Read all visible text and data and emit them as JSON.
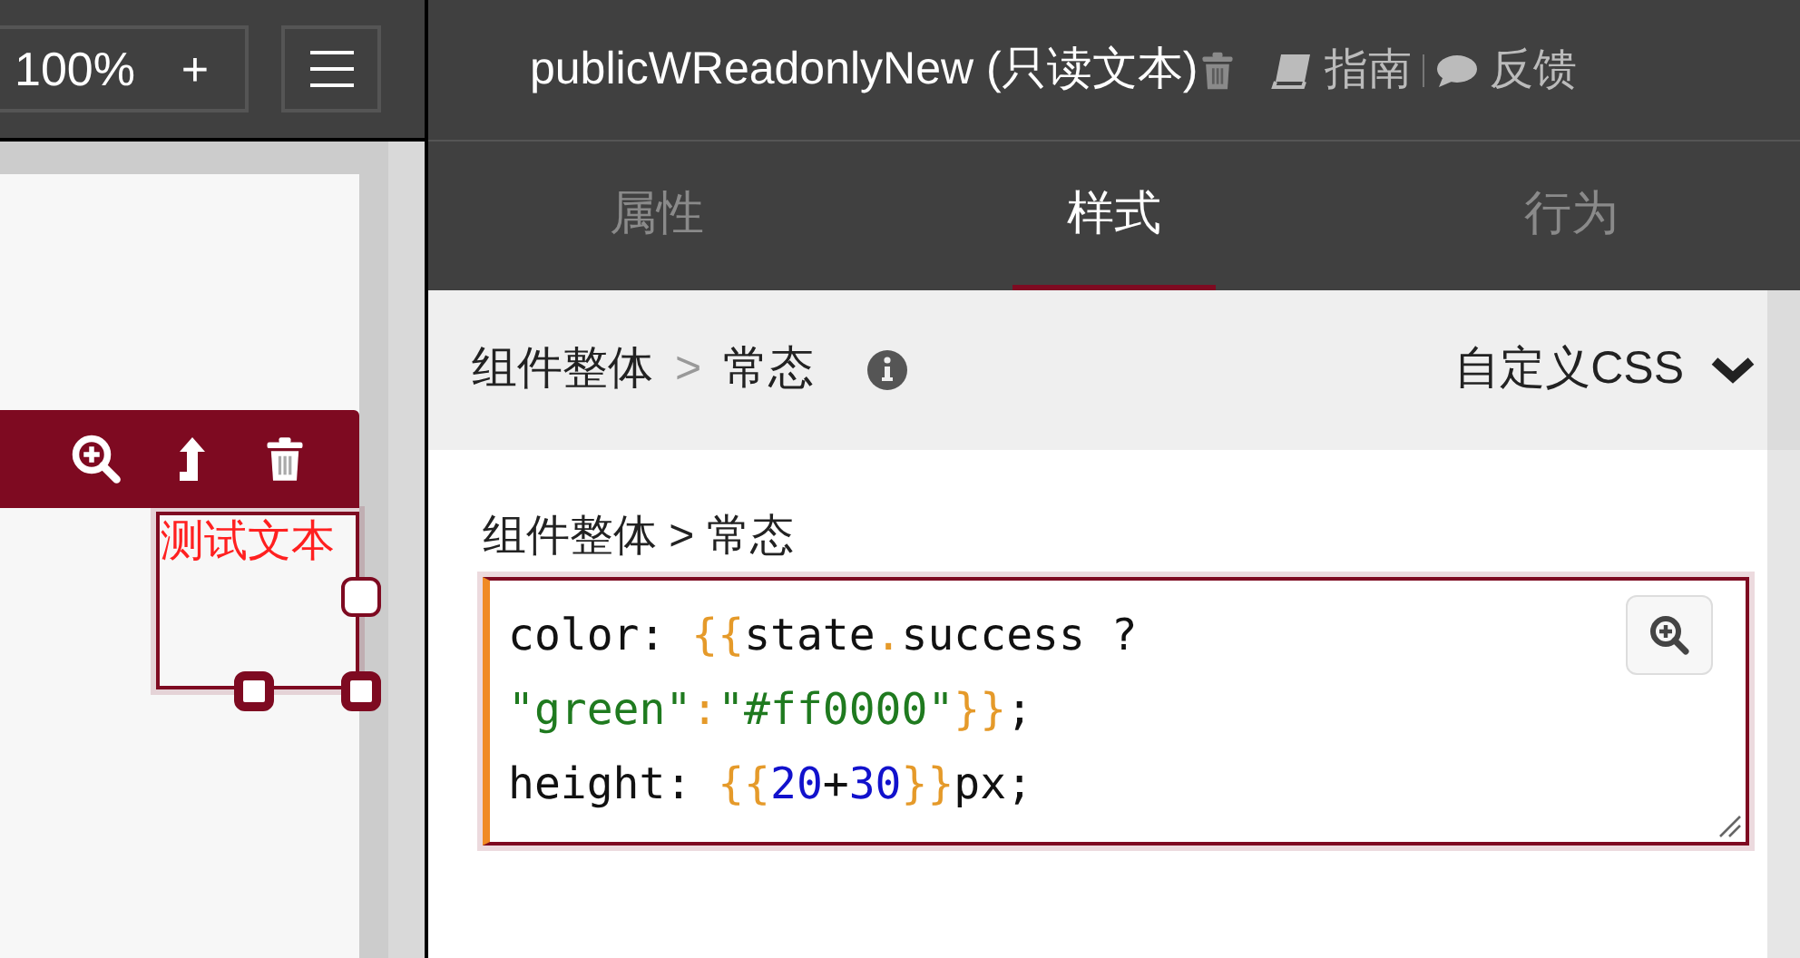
{
  "canvas_toolbar": {
    "zoom": "100%",
    "zoom_in": "+"
  },
  "canvas": {
    "component_text": "测试文本"
  },
  "header": {
    "title": "publicWReadonlyNew (只读文本)",
    "links": [
      {
        "kind": "guide",
        "label": "指南"
      },
      {
        "kind": "feedback",
        "label": "反馈"
      }
    ]
  },
  "tabs": [
    {
      "label": "属性",
      "selected": false
    },
    {
      "label": "样式",
      "selected": true
    },
    {
      "label": "行为",
      "selected": false
    }
  ],
  "section": {
    "breadcrumb": {
      "parent": "组件整体",
      "separator": ">",
      "current": "常态"
    },
    "mode": "自定义CSS"
  },
  "editor": {
    "label": "组件整体 > 常态",
    "lines": [
      [
        {
          "kind": "plain",
          "text": "color: "
        },
        {
          "kind": "brace",
          "text": "{{"
        },
        {
          "kind": "plain",
          "text": "state"
        },
        {
          "kind": "brace",
          "text": "."
        },
        {
          "kind": "plain",
          "text": "success ?"
        }
      ],
      [
        {
          "kind": "string",
          "text": "\"green\""
        },
        {
          "kind": "brace",
          "text": ":"
        },
        {
          "kind": "string",
          "text": "\"#ff0000\""
        },
        {
          "kind": "brace",
          "text": "}}"
        },
        {
          "kind": "plain",
          "text": ";"
        }
      ],
      [
        {
          "kind": "plain",
          "text": "height: "
        },
        {
          "kind": "brace",
          "text": "{{"
        },
        {
          "kind": "number",
          "text": "20"
        },
        {
          "kind": "plain",
          "text": "+"
        },
        {
          "kind": "number",
          "text": "30"
        },
        {
          "kind": "brace",
          "text": "}}"
        },
        {
          "kind": "plain",
          "text": "px;"
        }
      ]
    ]
  }
}
